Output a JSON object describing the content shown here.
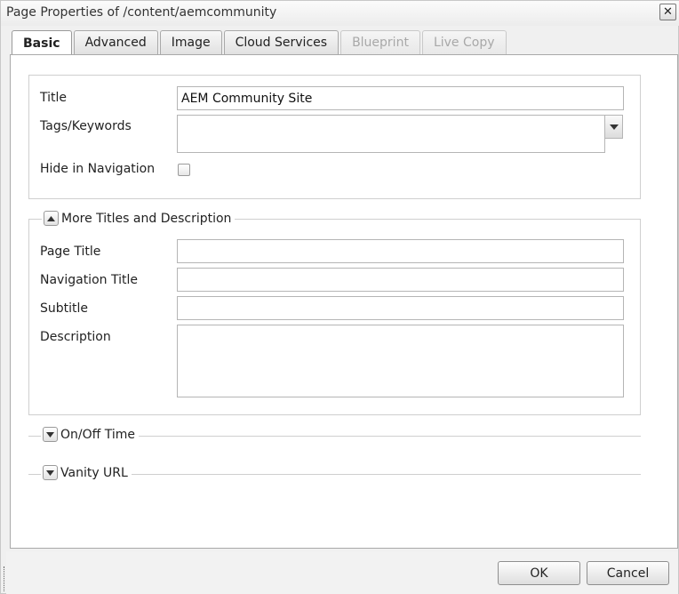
{
  "dialog": {
    "title": "Page Properties of /content/aemcommunity",
    "close_glyph": "✕"
  },
  "tabs": [
    {
      "label": "Basic",
      "active": true,
      "disabled": false
    },
    {
      "label": "Advanced",
      "active": false,
      "disabled": false
    },
    {
      "label": "Image",
      "active": false,
      "disabled": false
    },
    {
      "label": "Cloud Services",
      "active": false,
      "disabled": false
    },
    {
      "label": "Blueprint",
      "active": false,
      "disabled": true
    },
    {
      "label": "Live Copy",
      "active": false,
      "disabled": true
    }
  ],
  "basic": {
    "title_label": "Title",
    "title_value": "AEM Community Site",
    "tags_label": "Tags/Keywords",
    "tags_value": "",
    "hide_nav_label": "Hide in Navigation",
    "hide_nav_checked": false
  },
  "more_titles": {
    "legend": "More Titles and Description",
    "expanded": true,
    "page_title_label": "Page Title",
    "page_title_value": "",
    "nav_title_label": "Navigation Title",
    "nav_title_value": "",
    "subtitle_label": "Subtitle",
    "subtitle_value": "",
    "description_label": "Description",
    "description_value": ""
  },
  "on_off_time": {
    "legend": "On/Off Time",
    "expanded": false
  },
  "vanity_url": {
    "legend": "Vanity URL",
    "expanded": false
  },
  "footer": {
    "ok_label": "OK",
    "cancel_label": "Cancel"
  },
  "icons": {
    "close": "close-icon",
    "collapse": "chevron-up-icon",
    "expand": "chevron-down-icon",
    "combo": "chevron-down-icon"
  }
}
